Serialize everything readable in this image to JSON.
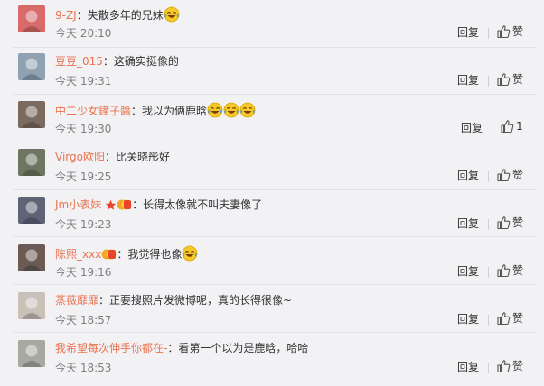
{
  "comments": [
    {
      "user": "9-ZJ",
      "text": "：失散多年的兄妹",
      "emoji_count": 1,
      "time": "今天 20:10",
      "reply": "回复",
      "like_label": "赞",
      "avatar_color": "#d86a6a"
    },
    {
      "user": "豆豆_015",
      "text": "：这确实挺像的",
      "emoji_count": 0,
      "time": "今天 19:31",
      "reply": "回复",
      "like_label": "赞",
      "avatar_color": "#8fa2b3"
    },
    {
      "user": "中二少女鐘子醬",
      "text": "：我以为俩鹿晗",
      "emoji_count": 3,
      "time": "今天 19:30",
      "reply": "回复",
      "like_label": "1",
      "avatar_color": "#7a6a60"
    },
    {
      "user": "Virgo欧阳",
      "text": "：比关晓彤好",
      "emoji_count": 0,
      "time": "今天 19:25",
      "reply": "回复",
      "like_label": "赞",
      "avatar_color": "#6f7562"
    },
    {
      "user": "Jm小表妹",
      "text": "：长得太像就不叫夫妻像了",
      "emoji_count": 0,
      "star": true,
      "vip_badge": true,
      "time": "今天 19:23",
      "reply": "回复",
      "like_label": "赞",
      "avatar_color": "#5d6475"
    },
    {
      "user": "陈熙_xxx",
      "text": "：我觉得也像",
      "emoji_count": 1,
      "vip_badge": true,
      "time": "今天 19:16",
      "reply": "回复",
      "like_label": "赞",
      "avatar_color": "#6b5b54"
    },
    {
      "user": "蒸薇靡靡",
      "text": "：正要搜照片发微博呢，真的长得很像~",
      "emoji_count": 0,
      "time": "今天 18:57",
      "reply": "回复",
      "like_label": "赞",
      "avatar_color": "#c9c0b8"
    },
    {
      "user": "我希望每次伸手你都在-",
      "text": "：看第一个以为是鹿晗，哈哈",
      "emoji_count": 0,
      "time": "今天 18:53",
      "reply": "回复",
      "like_label": "赞",
      "avatar_color": "#a8a8a0"
    }
  ],
  "colors": {
    "username": "#eb7350",
    "time": "#808080",
    "background": "#f2f2f5"
  },
  "icons": {
    "like": "thumbs-up-icon",
    "emoji": "laugh-cry-emoji-icon",
    "star": "star-icon",
    "vip": "vip-badge-icon"
  }
}
